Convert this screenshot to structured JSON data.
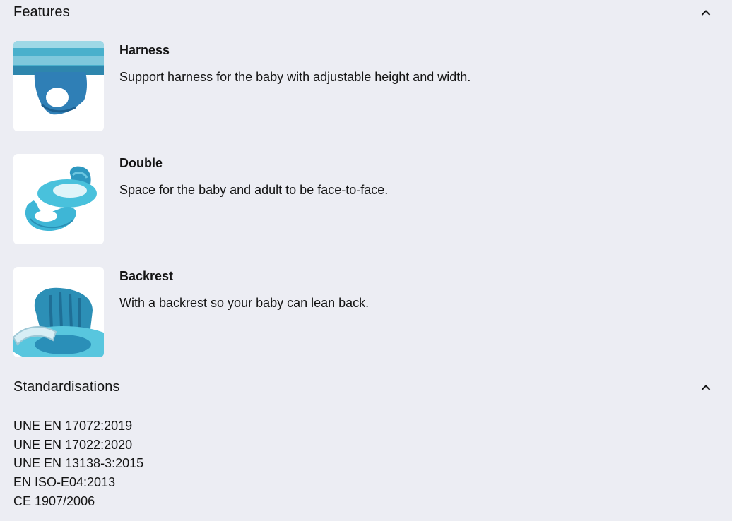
{
  "features_section": {
    "title": "Features",
    "items": [
      {
        "title": "Harness",
        "description": "Support harness for the baby with adjustable height and width.",
        "image_icon": "harness-image"
      },
      {
        "title": "Double",
        "description": "Space for the baby and adult to be face-to-face.",
        "image_icon": "double-float-image"
      },
      {
        "title": "Backrest",
        "description": "With a backrest so your baby can lean back.",
        "image_icon": "backrest-image"
      }
    ]
  },
  "standards_section": {
    "title": "Standardisations",
    "items": [
      "UNE EN 17072:2019",
      "UNE EN 17022:2020",
      "UNE EN 13138-3:2015",
      "EN ISO-E04:2013",
      "CE 1907/2006"
    ]
  },
  "colors": {
    "background": "#ecedf3",
    "text": "#141414",
    "divider": "#cdcdd3",
    "product": "#3aa0c8"
  }
}
